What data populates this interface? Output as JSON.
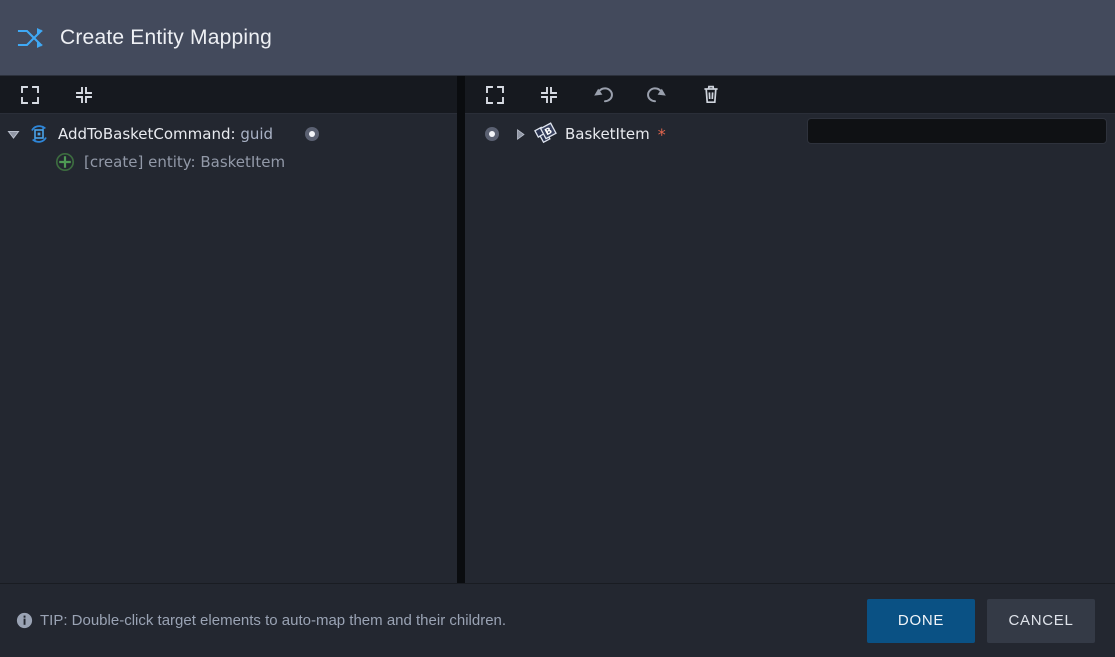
{
  "window": {
    "title": "Create Entity Mapping",
    "title_icon": "shuffle-icon",
    "accent_color": "#3fa9f5",
    "header_bg": "#434a5c",
    "panel_bg": "#232730",
    "toolbar_bg": "#16191f"
  },
  "source_panel": {
    "toolbar": [
      {
        "name": "expand-all-icon",
        "tooltip": "Expand all"
      },
      {
        "name": "collapse-all-icon",
        "tooltip": "Collapse all"
      }
    ],
    "tree": [
      {
        "twisty": "chevron-down-icon",
        "icon": "command-icon",
        "label": "AddToBasketCommand:",
        "type": "guid",
        "has_connector": true,
        "indent": 0
      },
      {
        "twisty": "",
        "icon": "create-plus-icon",
        "label": "[create] entity: BasketItem",
        "type": "",
        "has_connector": false,
        "indent": 1
      }
    ]
  },
  "target_panel": {
    "toolbar": [
      {
        "name": "expand-all-icon",
        "tooltip": "Expand all"
      },
      {
        "name": "collapse-all-icon",
        "tooltip": "Collapse all"
      },
      {
        "name": "undo-icon",
        "tooltip": "Undo"
      },
      {
        "name": "redo-icon",
        "tooltip": "Redo"
      },
      {
        "name": "trash-icon",
        "tooltip": "Delete"
      }
    ],
    "tree": [
      {
        "twisty": "chevron-right-icon",
        "icon": "entity-icon",
        "label": "BasketItem",
        "required_marker": "*",
        "has_connector": true,
        "value": "",
        "value_placeholder": ""
      }
    ]
  },
  "footer": {
    "tip_icon": "info-icon",
    "tip_text": "TIP: Double-click target elements to auto-map them and their children.",
    "done_label": "DONE",
    "cancel_label": "CANCEL",
    "done_color": "#0a5184",
    "cancel_color": "#343a46"
  }
}
